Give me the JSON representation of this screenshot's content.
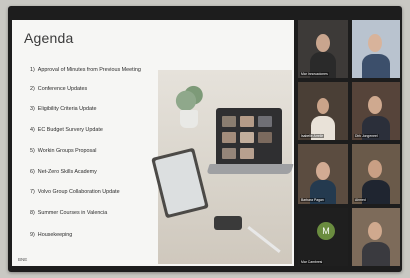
{
  "slide": {
    "title": "Agenda",
    "items": [
      {
        "num": "1)",
        "text": "Approval of Minutes from Previous Meeting"
      },
      {
        "num": "2)",
        "text": "Conference Updates"
      },
      {
        "num": "3)",
        "text": "Eligibility Criteria Update"
      },
      {
        "num": "4)",
        "text": "EC Budget Survery Update"
      },
      {
        "num": "5)",
        "text": "Workin Groups Proposal"
      },
      {
        "num": "6)",
        "text": "Net-Zero Skills Academy"
      },
      {
        "num": "7)",
        "text": "Volvo Group Collaboration Update"
      },
      {
        "num": "8)",
        "text": "Summer Courses in Valencia"
      },
      {
        "num": "9)",
        "text": "Housekeeping"
      }
    ],
    "footer": "BNE"
  },
  "participants": [
    {
      "name": "Mar Innovaciones"
    },
    {
      "name": ""
    },
    {
      "name": "Isabelle Arrelle"
    },
    {
      "name": "Dirk Jongeneel"
    },
    {
      "name": "Barbara Pagan"
    },
    {
      "name": "Ahmed"
    },
    {
      "name": "Mar Cambresi",
      "initial": "M"
    },
    {
      "name": ""
    }
  ],
  "colors": {
    "avatar": "#6a8c3f",
    "frame": "#1d1d1d",
    "slide_bg": "#f6f6f4"
  }
}
